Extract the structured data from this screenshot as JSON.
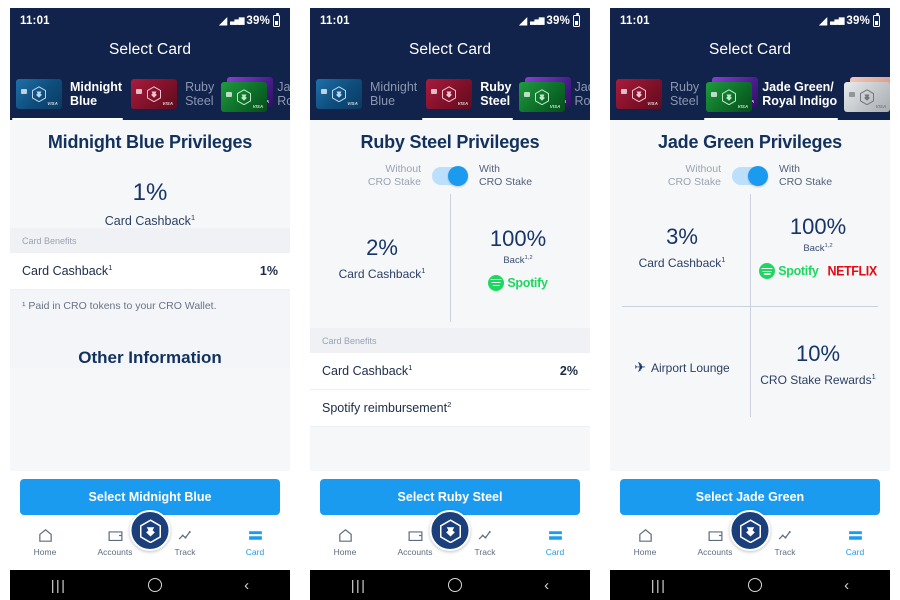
{
  "statusbar": {
    "time": "11:01",
    "battery_pct": "39%",
    "wifi_icon": "wifi-icon",
    "signal_icon": "signal-icon",
    "battery_icon": "battery-icon"
  },
  "header": {
    "title": "Select Card"
  },
  "nav": {
    "items": [
      {
        "label": "Home",
        "icon": "home-icon",
        "active": false
      },
      {
        "label": "Accounts",
        "icon": "wallet-icon",
        "active": false
      },
      {
        "label": "Track",
        "icon": "chart-line-icon",
        "active": false
      },
      {
        "label": "Card",
        "icon": "credit-card-icon",
        "active": true
      }
    ],
    "center_icon": "cro-logo-icon"
  },
  "sysbar": {
    "recents": "|||",
    "home": "home-circle-icon",
    "back": "‹"
  },
  "colors": {
    "accent": "#1b9bf0",
    "header_bg": "#11224b",
    "title_text": "#12315e",
    "spotify_green": "#1ed760",
    "netflix_red": "#e50914"
  },
  "toggle": {
    "left_line1": "Without",
    "left_line2": "CRO Stake",
    "right_line1": "With",
    "right_line2": "CRO Stake",
    "state": "on"
  },
  "screens": [
    {
      "id": "midnight-blue",
      "tabs": [
        {
          "label_line1": "Midnight",
          "label_line2": "Blue",
          "card": "blue",
          "active": true
        },
        {
          "label_line1": "Ruby",
          "label_line2": "Steel",
          "card": "ruby",
          "active": false
        },
        {
          "label_line1": "Jad",
          "label_line2": "Ro",
          "card": "jade",
          "active": false
        }
      ],
      "panel_title": "Midnight Blue Privileges",
      "has_toggle": false,
      "big_stat": {
        "num": "1%",
        "cap": "Card Cashback",
        "sup": "1"
      },
      "benefits_header": "Card Benefits",
      "benefits": [
        {
          "label": "Card Cashback",
          "sup": "1",
          "value": "1%"
        }
      ],
      "footnote": "¹ Paid in CRO tokens to your CRO Wallet.",
      "other_information": "Other Information",
      "cta": "Select Midnight Blue"
    },
    {
      "id": "ruby-steel",
      "tabs": [
        {
          "label_line1": "Midnight",
          "label_line2": "Blue",
          "card": "blue",
          "active": false
        },
        {
          "label_line1": "Ruby",
          "label_line2": "Steel",
          "card": "ruby",
          "active": true
        },
        {
          "label_line1": "Jad",
          "label_line2": "Ro",
          "card": "jade",
          "active": false
        }
      ],
      "panel_title": "Ruby Steel Privileges",
      "has_toggle": true,
      "quadrants": [
        {
          "num": "2%",
          "cap": "Card Cashback",
          "sup": "1",
          "brands": []
        },
        {
          "num": "100%",
          "cap": "Back",
          "sup": "1,2",
          "brands": [
            "spotify"
          ]
        }
      ],
      "benefits_header": "Card Benefits",
      "benefits": [
        {
          "label": "Card Cashback",
          "sup": "1",
          "value": "2%"
        },
        {
          "label": "Spotify reimbursement",
          "sup": "2",
          "value": ""
        }
      ],
      "cta": "Select Ruby Steel"
    },
    {
      "id": "jade-green",
      "tabs": [
        {
          "label_line1": "Ruby",
          "label_line2": "Steel",
          "card": "ruby",
          "active": false
        },
        {
          "label_line1": "Jade Green/",
          "label_line2": "Royal Indigo",
          "card": "jade",
          "active": true
        },
        {
          "label_line1": "",
          "label_line2": "",
          "card": "silver",
          "active": false
        }
      ],
      "panel_title": "Jade Green Privileges",
      "has_toggle": true,
      "quadrants": [
        {
          "num": "3%",
          "cap": "Card Cashback",
          "sup": "1",
          "brands": []
        },
        {
          "num": "100%",
          "cap": "Back",
          "sup": "1,2",
          "brands": [
            "spotify",
            "netflix"
          ]
        },
        {
          "num": "",
          "cap": "Airport Lounge",
          "sup": "",
          "icon": "airplane-icon",
          "brands": []
        },
        {
          "num": "10%",
          "cap": "CRO Stake Rewards",
          "sup": "1",
          "brands": []
        }
      ],
      "cta": "Select Jade Green"
    }
  ]
}
